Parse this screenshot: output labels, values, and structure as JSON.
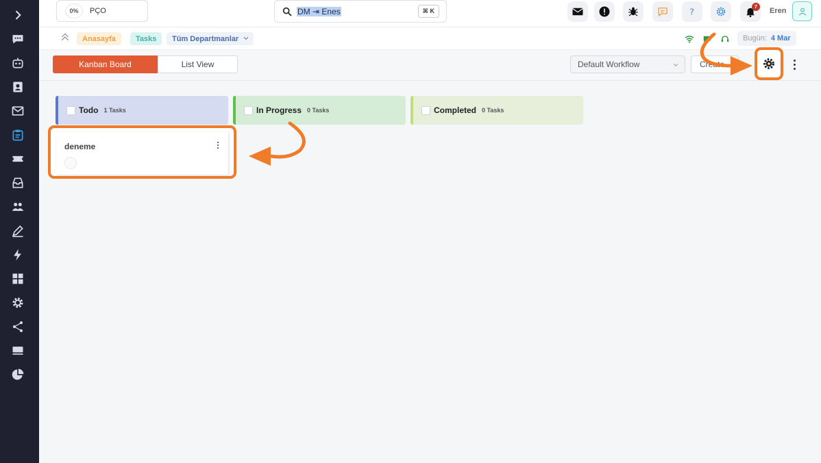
{
  "company": {
    "progress": "0%",
    "name": "PÇO"
  },
  "search": {
    "value": "DM ⇥ Enes",
    "shortcut": "⌘ K"
  },
  "header": {
    "icons": [
      "mail-icon",
      "alert-icon",
      "bug-icon",
      "chat-icon",
      "help-icon",
      "settings-icon",
      "bell-icon"
    ],
    "notification_count": "7",
    "username": "Eren"
  },
  "breadcrumb": {
    "home": "Anasayfa",
    "tasks": "Tasks",
    "department": "Tüm Departmanlar"
  },
  "today": {
    "label": "Bugün:",
    "date": "4 Mar"
  },
  "toolbar": {
    "kanban_label": "Kanban Board",
    "list_label": "List View",
    "workflow": "Default Workflow",
    "create_label": "Create"
  },
  "columns": [
    {
      "title": "Todo",
      "count": "1 Tasks",
      "color": "#5d77cf"
    },
    {
      "title": "In Progress",
      "count": "0 Tasks",
      "color": "#5fbf4a"
    },
    {
      "title": "Completed",
      "count": "0 Tasks",
      "color": "#c3dc7c"
    }
  ],
  "tasks": [
    {
      "title": "deneme"
    }
  ],
  "sidebar": {
    "items": [
      "expand-icon",
      "chat-icon",
      "robot-icon",
      "contact-icon",
      "mail-icon",
      "tasks-icon",
      "ticket-icon",
      "inbox-icon",
      "team-icon",
      "sign-icon",
      "bolt-icon",
      "grid-icon",
      "gear-icon",
      "share-icon",
      "keyboard-icon",
      "chart-icon"
    ]
  },
  "colors": {
    "accent": "#e25a33",
    "annotation": "#f07c2a",
    "sidebar_bg": "#1f2030"
  }
}
